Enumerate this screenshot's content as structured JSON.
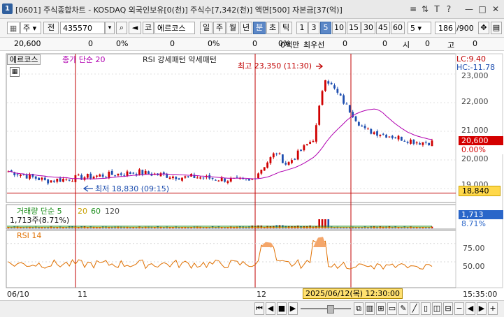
{
  "window": {
    "app_id": "1",
    "title": "[0601] 주식종합차트 - KOSDAQ 외국인보유[0(천)] 주식수[7,342(천)] 액면[500] 자본금[37(억)]",
    "controls": [
      "≡",
      "⇅",
      "T",
      "?",
      "—",
      "□",
      "✕"
    ]
  },
  "toolbar": {
    "market_select": "주",
    "prev_label": "전",
    "code_value": "435570",
    "market_label": "코",
    "stock_name": "에르코스",
    "periods": [
      "일",
      "주",
      "월",
      "년",
      "분",
      "초",
      "틱"
    ],
    "active_period": "분",
    "minutes": [
      "1",
      "3",
      "5",
      "10",
      "15",
      "30",
      "45",
      "60"
    ],
    "active_minute": "5",
    "minute_select": "5",
    "count": "186",
    "total": "/900"
  },
  "infobar": {
    "price": "20,600",
    "v1": "0",
    "v2": "0%",
    "v3": "0",
    "v4": "0%",
    "v5": "0",
    "v6": "0%",
    "volume": "0백만",
    "order_label": "최우선",
    "v7": "0",
    "v8": "0",
    "open_label": "시",
    "open": "0",
    "high_label": "고",
    "high": "0"
  },
  "chart": {
    "stock_tag": "에르코스",
    "ma_label": "종가 단순 20",
    "rsi_label": "RSI 강세패턴 약세패턴",
    "max_label": "최고 23,350 (11:30)",
    "min_label": "최저 18,830 (09:15)",
    "lc_label": "LC:9.40",
    "hc_label": "HC:-11.78",
    "price_ticks": [
      "23,000",
      "22,000",
      "21,000",
      "20,000",
      "19,000"
    ],
    "current_price": "20,600",
    "current_pct": "0.00%",
    "ref_price": "18,840",
    "volume_panel_label": "거래량 단순 5",
    "volume_ma": [
      "20",
      "60",
      "120"
    ],
    "volume_value": "1,713주(8.71%)",
    "volume_tag": "1,713",
    "volume_pct": "8.71%",
    "rsi_panel_label": "RSI 14",
    "rsi_ticks": [
      "75.00",
      "50.00"
    ],
    "dates": [
      "06/10",
      "11",
      "12"
    ],
    "cursor_date": "2025/06/12(목) 12:30:00",
    "time_label": "15:35:00"
  },
  "colors": {
    "up": "#d00000",
    "down": "#1f4fb0",
    "ma": "#b000b0",
    "rsi": "#e07000",
    "date_line": "#c00000",
    "cursor_box": "#ffe070"
  }
}
